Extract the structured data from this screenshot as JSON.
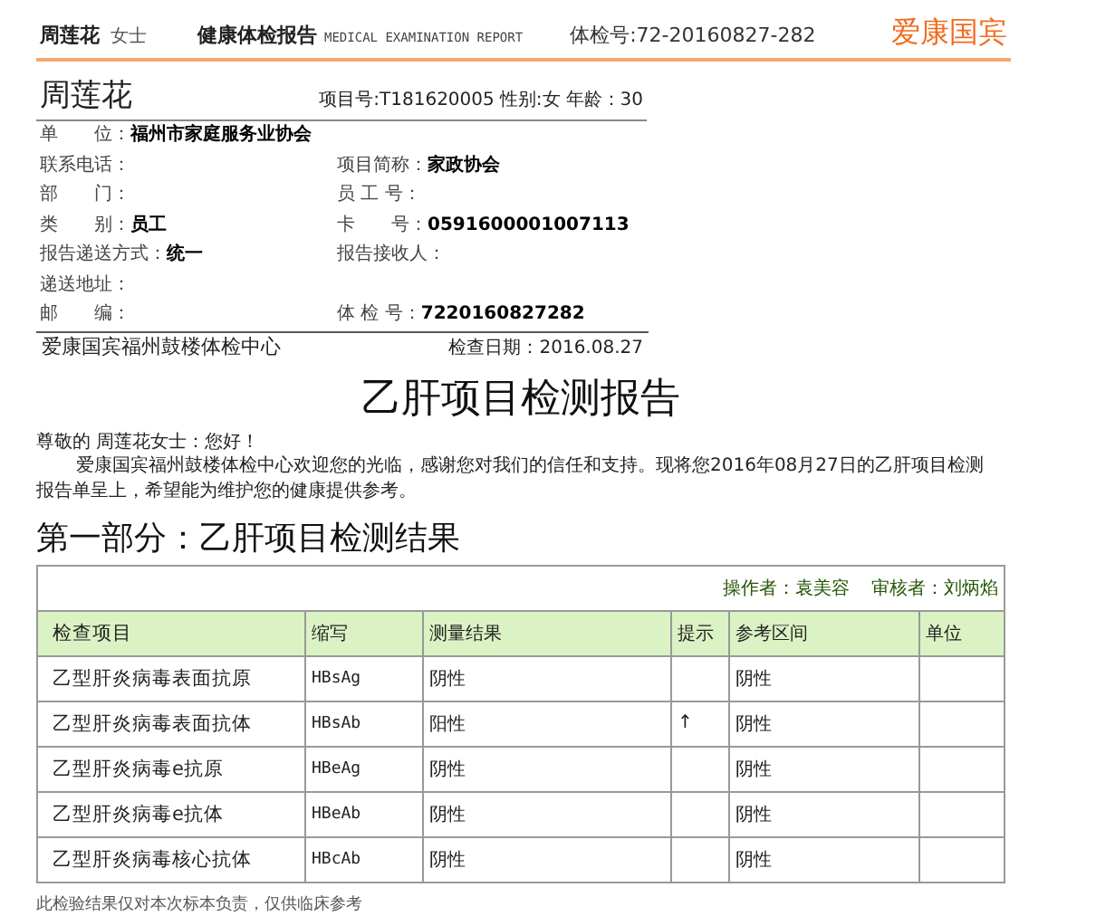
{
  "header": {
    "name": "周莲花",
    "title_suffix": "女士",
    "report_title": "健康体检报告",
    "report_title_en": "MEDICAL EXAMINATION REPORT",
    "exam_no": "体检号:72-20160827-282",
    "brand": "爱康国宾"
  },
  "patient": {
    "name": "周莲花",
    "project_no": "项目号:T181620005",
    "gender": "性别:女",
    "age": "年龄：30"
  },
  "info_rows": [
    [
      {
        "label": "单　　位：",
        "value": "福州市家庭服务业协会"
      }
    ],
    [
      {
        "label": "联系电话："
      },
      {
        "label": "项目简称：",
        "value": "家政协会"
      }
    ],
    [
      {
        "label": "部　　门："
      },
      {
        "label": "员 工 号："
      }
    ],
    [
      {
        "label": "类　　别：",
        "value": "员工"
      },
      {
        "label": "卡　　号：",
        "value": "0591600001007113"
      }
    ],
    [
      {
        "label": "报告递送方式：",
        "value": "统一"
      },
      {
        "label": "报告接收人："
      }
    ],
    [
      {
        "label": "递送地址："
      }
    ],
    [
      {
        "label": "邮　　编："
      },
      {
        "label": "体 检 号：",
        "value": "7220160827282"
      }
    ]
  ],
  "center": {
    "name": "爱康国宾福州鼓楼体检中心",
    "date": "检查日期：2016.08.27"
  },
  "report_heading": "乙肝项目检测报告",
  "greeting": "尊敬的 周莲花女士：您好！",
  "intro": "爱康国宾福州鼓楼体检中心欢迎您的光临，感谢您对我们的信任和支持。现将您2016年08月27日的乙肝项目检测报告单呈上，希望能为维护您的健康提供参考。",
  "section_heading": "第一部分：乙肝项目检测结果",
  "table": {
    "operator": "操作者：袁美容",
    "reviewer": "审核者：刘炳焰",
    "columns": [
      "检查项目",
      "缩写",
      "测量结果",
      "提示",
      "参考区间",
      "单位"
    ],
    "rows": [
      [
        "乙型肝炎病毒表面抗原",
        "HBsAg",
        "阴性",
        null,
        "阴性",
        null
      ],
      [
        "乙型肝炎病毒表面抗体",
        "HBsAb",
        "阳性",
        "↑",
        "阴性",
        null
      ],
      [
        "乙型肝炎病毒e抗原",
        "HBeAg",
        "阴性",
        null,
        "阴性",
        null
      ],
      [
        "乙型肝炎病毒e抗体",
        "HBeAb",
        "阴性",
        null,
        "阴性",
        null
      ],
      [
        "乙型肝炎病毒核心抗体",
        "HBcAb",
        "阴性",
        null,
        "阴性",
        null
      ]
    ]
  },
  "footnote": "此检验结果仅对本次标本负责，仅供临床参考"
}
